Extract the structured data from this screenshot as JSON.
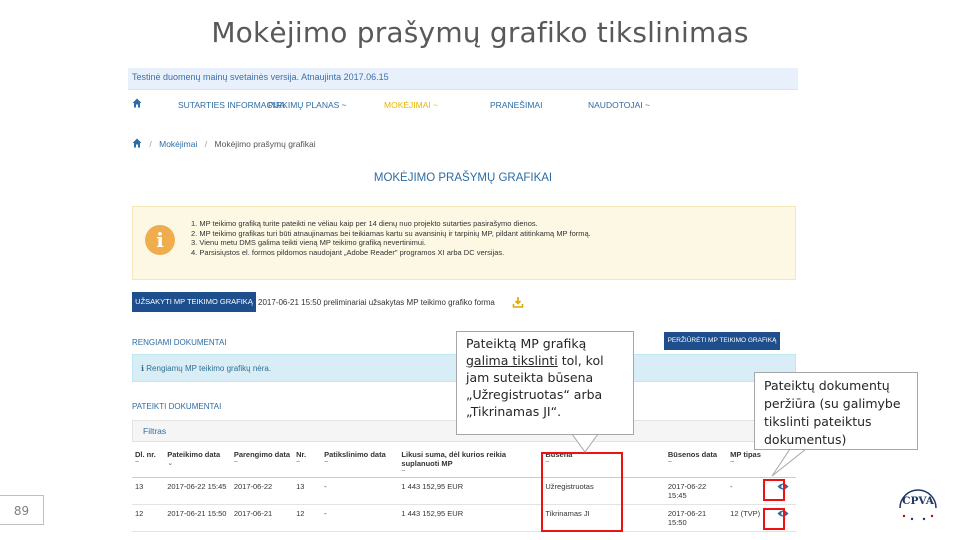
{
  "slide": {
    "title": "Mokėjimo prašymų grafiko tikslinimas",
    "page_number": "89"
  },
  "app": {
    "test_notice": "Testinė duomenų mainų svetainės versija. Atnaujinta 2017.06.15",
    "nav": [
      {
        "label": "SUTARTIES INFORMACIJA",
        "active": false
      },
      {
        "label": "PIRKIMŲ PLANAS ~",
        "active": false
      },
      {
        "label": "MOKĖJIMAI ~",
        "active": true
      },
      {
        "label": "PRANEŠIMAI",
        "active": false
      },
      {
        "label": "NAUDOTOJAI ~",
        "active": false
      }
    ],
    "breadcrumb": [
      "Mokėjimai",
      "Mokėjimo prašymų grafikai"
    ],
    "page_heading": "MOKĖJIMO PRAŠYMŲ GRAFIKAI",
    "info_items": [
      "1.  MP teikimo grafiką turite pateikti ne vėliau kaip per 14 dienų nuo projekto sutarties pasirašymo dienos.",
      "2.  MP teikimo grafikas turi būti atnaujinamas bei teikiamas kartu su avansinių ir tarpinių MP, pildant atitinkamą MP formą.",
      "3.  Vienu metu DMS galima teikti vieną MP teikimo grafiką nevertinimui.",
      "4.  Parsisiųstos el. formos pildomos naudojant „Adobe Reader\" programos XI arba DC versijas."
    ],
    "order_button": "UŽSAKYTI MP TEIKIMO GRAFIKĄ",
    "order_note": "2017-06-21 15:50 preliminariai užsakytas MP teikimo grafiko forma",
    "section_preparing": "RENGIAMI DOKUMENTAI",
    "view_button": "PERŽIŪRĖTI MP TEIKIMO GRAFIKĄ",
    "preparing_alert": "Rengiamų MP teikimo grafikų nėra.",
    "section_submitted": "PATEIKTI DOKUMENTAI",
    "filter_label": "Filtras",
    "table": {
      "headers": [
        {
          "label": "Dl. nr.",
          "sort": "~"
        },
        {
          "label": "Pateikimo data",
          "sort": "⌄"
        },
        {
          "label": "Parengimo data",
          "sort": "~"
        },
        {
          "label": "Nr.",
          "sort": "~"
        },
        {
          "label": "Patikslinimo data",
          "sort": "~"
        },
        {
          "label": "Likusi suma, dėl kurios reikia suplanuoti MP",
          "sort": "~"
        },
        {
          "label": "Būsena",
          "sort": "~"
        },
        {
          "label": "Būsenos data",
          "sort": "~"
        },
        {
          "label": "MP tipas",
          "sort": "~"
        }
      ],
      "rows": [
        [
          "13",
          "2017-06-22 15:45",
          "2017-06-22",
          "13",
          "-",
          "1 443 152,95 EUR",
          "Užregistruotas",
          "2017-06-22 15:45",
          "-"
        ],
        [
          "12",
          "2017-06-21 15:50",
          "2017-06-21",
          "12",
          "-",
          "1 443 152,95 EUR",
          "Tikrinamas JI",
          "2017-06-21 15:50",
          "12 (TVP)"
        ]
      ]
    }
  },
  "callouts": {
    "left_underlined": "galima tikslinti",
    "left_before": "Pateiktą MP grafiką",
    "left_after": "tol, kol jam suteikta būsena „Užregistruotas“ arba „Tikrinamas JI“.",
    "right": "Pateiktų dokumentų peržiūra (su galimybe tikslinti pateiktus dokumentus)"
  },
  "logo": {
    "text": "CPVA"
  },
  "colors": {
    "accent": "#1f4e8c",
    "link": "#2d6ca2",
    "highlight_box": "#e11111"
  }
}
